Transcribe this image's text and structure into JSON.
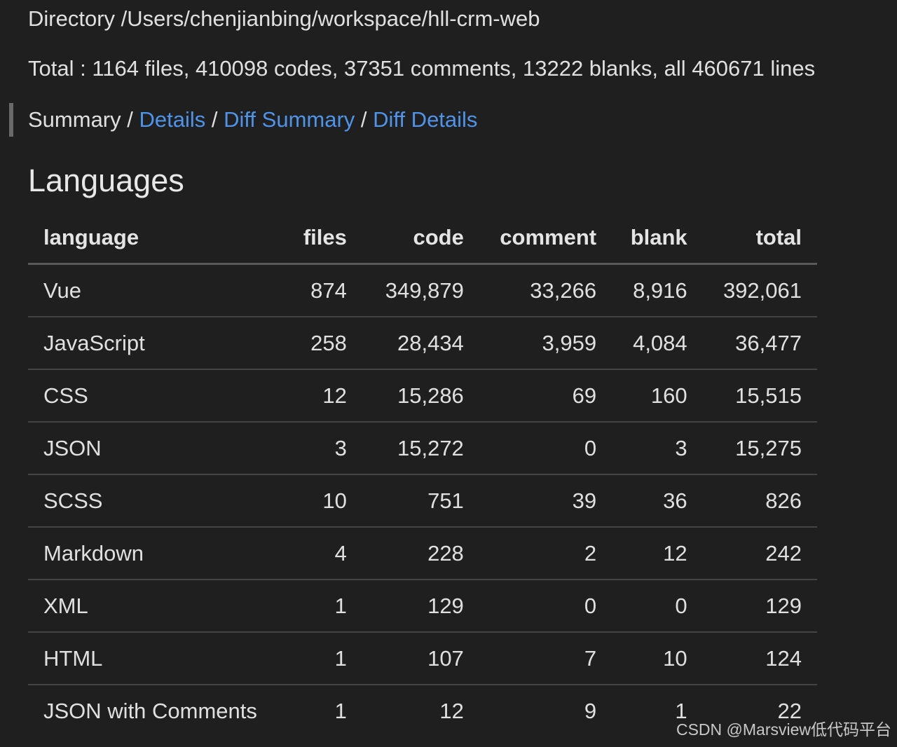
{
  "header": {
    "directory_label": "Directory /Users/chenjianbing/workspace/hll-crm-web",
    "total_label": "Total : 1164 files, 410098 codes, 37351 comments, 13222 blanks, all 460671 lines"
  },
  "nav": {
    "summary": "Summary",
    "separator": " / ",
    "details": "Details",
    "diff_summary": "Diff Summary",
    "diff_details": "Diff Details"
  },
  "section": {
    "title": "Languages"
  },
  "table": {
    "columns": [
      "language",
      "files",
      "code",
      "comment",
      "blank",
      "total"
    ],
    "rows": [
      [
        "Vue",
        "874",
        "349,879",
        "33,266",
        "8,916",
        "392,061"
      ],
      [
        "JavaScript",
        "258",
        "28,434",
        "3,959",
        "4,084",
        "36,477"
      ],
      [
        "CSS",
        "12",
        "15,286",
        "69",
        "160",
        "15,515"
      ],
      [
        "JSON",
        "3",
        "15,272",
        "0",
        "3",
        "15,275"
      ],
      [
        "SCSS",
        "10",
        "751",
        "39",
        "36",
        "826"
      ],
      [
        "Markdown",
        "4",
        "228",
        "2",
        "12",
        "242"
      ],
      [
        "XML",
        "1",
        "129",
        "0",
        "0",
        "129"
      ],
      [
        "HTML",
        "1",
        "107",
        "7",
        "10",
        "124"
      ],
      [
        "JSON with Comments",
        "1",
        "12",
        "9",
        "1",
        "22"
      ]
    ]
  },
  "watermark": "CSDN @Marsview低代码平台"
}
